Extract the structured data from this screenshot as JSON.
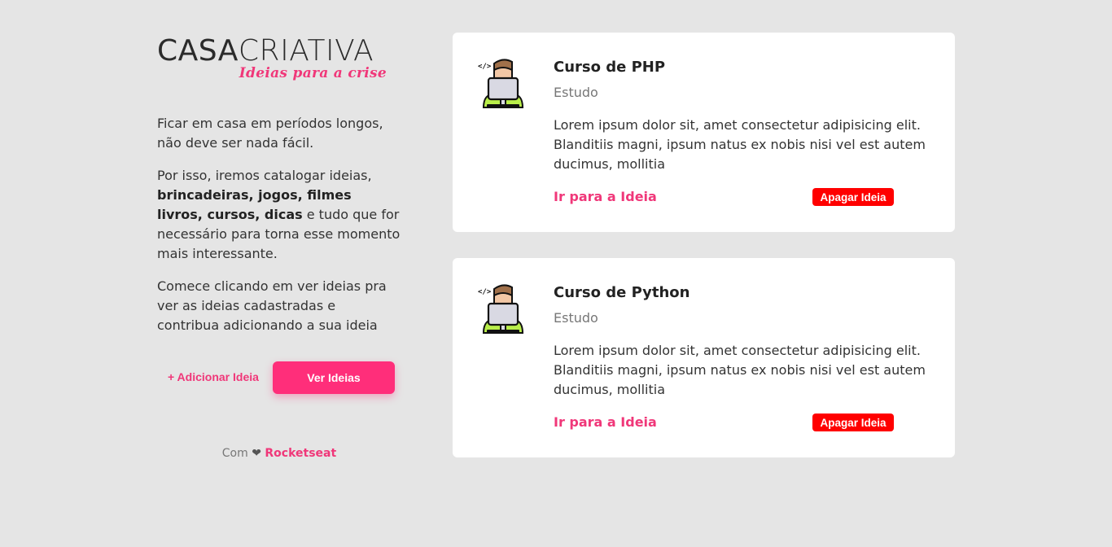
{
  "logo": {
    "part1": "CASA",
    "part2": "CRIATIVA",
    "tagline": "Ideias para a crise"
  },
  "intro": {
    "p1": "Ficar em casa em períodos longos, não deve ser nada fácil.",
    "p2_start": "Por isso, iremos catalogar ideias, ",
    "p2_bold": "brincadeiras, jogos, filmes livros, cursos, dicas",
    "p2_end": " e tudo que for necessário para torna esse momento mais interessante.",
    "p3": "Comece clicando em ver ideias pra ver as ideias cadastradas e contribua adicionando a sua ideia"
  },
  "actions": {
    "add_label": "+ Adicionar Ideia",
    "see_label": "Ver Ideias"
  },
  "footer": {
    "prefix": "Com",
    "heart": "❤",
    "brand": "Rocketseat"
  },
  "ideas": [
    {
      "title": "Curso de PHP",
      "category": "Estudo",
      "description": "Lorem ipsum dolor sit, amet consectetur adipisicing elit. Blanditiis magni, ipsum natus ex nobis nisi vel est autem ducimus, mollitia",
      "link_label": "Ir para a Ideia",
      "delete_label": "Apagar Ideia",
      "icon": "developer-laptop-icon"
    },
    {
      "title": "Curso de Python",
      "category": "Estudo",
      "description": "Lorem ipsum dolor sit, amet consectetur adipisicing elit. Blanditiis magni, ipsum natus ex nobis nisi vel est autem ducimus, mollitia",
      "link_label": "Ir para a Ideia",
      "delete_label": "Apagar Ideia",
      "icon": "developer-laptop-icon"
    }
  ],
  "colors": {
    "background": "#e5e5e5",
    "accent": "#f03779",
    "button": "#ff2e7a",
    "delete": "#ff0000",
    "card": "#ffffff"
  }
}
